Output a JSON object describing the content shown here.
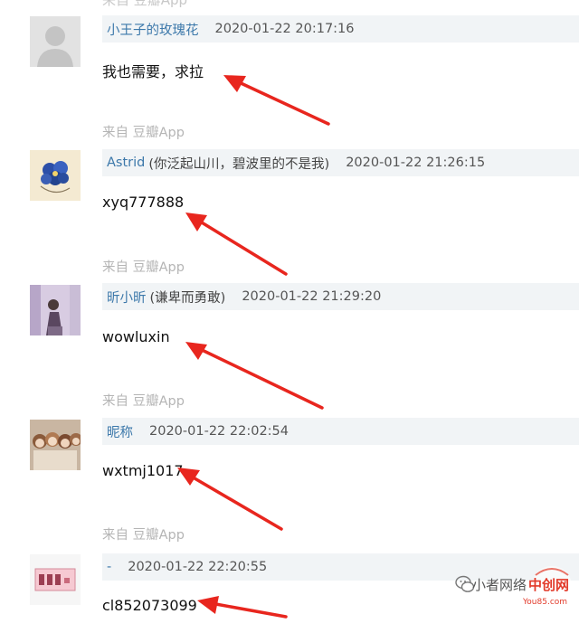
{
  "page": {
    "top_partial": "来自 豆瓣App"
  },
  "comments": [
    {
      "author": "小王子的玫瑰花",
      "note": "",
      "time": "2020-01-22 20:17:16",
      "text": "我也需要，求拉",
      "source": "来自 豆瓣App",
      "avatar": "default-avatar"
    },
    {
      "author": "Astrid",
      "note": "(你泛起山川，碧波里的不是我)",
      "time": "2020-01-22 21:26:15",
      "text": "xyq777888",
      "source": "来自 豆瓣App",
      "avatar": "blue-flower-avatar"
    },
    {
      "author": "昕小昕",
      "note": "(谦卑而勇敢)",
      "time": "2020-01-22 21:29:20",
      "text": "wowluxin",
      "source": "来自 豆瓣App",
      "avatar": "girl-photo-avatar"
    },
    {
      "author": "昵称",
      "note": "",
      "time": "2020-01-22 22:02:54",
      "text": "wxtmj1017",
      "source": "来自 豆瓣App",
      "avatar": "dolls-photo-avatar"
    },
    {
      "author": "-",
      "note": "",
      "time": "2020-01-22 22:20:55",
      "text": "cl852073099",
      "source": "",
      "avatar": "pink-card-avatar"
    }
  ],
  "watermark": {
    "account": "小者网络",
    "brand": "中创网",
    "site": "You85.com",
    "icon": "wechat-icon"
  },
  "annotations": {
    "arrow_color": "#e8261e",
    "arrow_count": 5
  }
}
